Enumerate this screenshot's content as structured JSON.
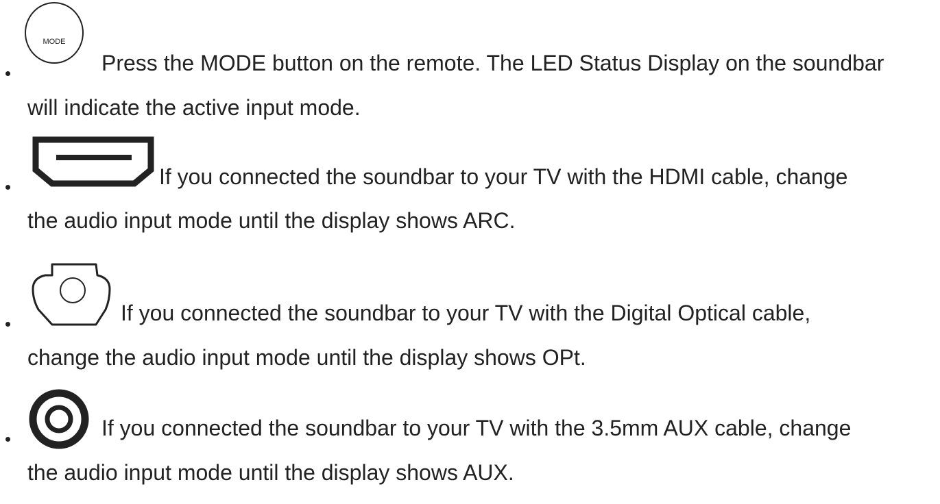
{
  "items": [
    {
      "icon": "mode-button-icon",
      "icon_text": "MODE",
      "line1": "Press the MODE button on the remote. The LED Status Display on the soundbar",
      "line2": "will indicate the active input mode."
    },
    {
      "icon": "hdmi-port-icon",
      "line1": "If you connected the soundbar to your TV with the HDMI cable, change",
      "line2": "the audio input mode until the display shows ARC."
    },
    {
      "icon": "optical-port-icon",
      "line1": "If you connected the soundbar to your TV with the Digital Optical cable,",
      "line2": "change the audio input mode until the display shows OPt."
    },
    {
      "icon": "aux-jack-icon",
      "line1": "If you connected the soundbar to your TV with the 3.5mm AUX cable, change",
      "line2": "the audio input mode until the display shows AUX."
    }
  ]
}
